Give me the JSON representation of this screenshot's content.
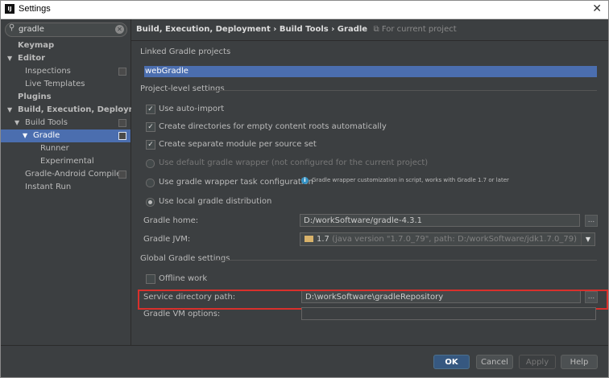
{
  "window": {
    "title": "Settings",
    "close": "✕",
    "app_icon": "IJ"
  },
  "search": {
    "value": "gradle",
    "clear": "✕",
    "icon": "⚲"
  },
  "sidebar": {
    "items": [
      {
        "label": "Keymap"
      },
      {
        "label": "Editor",
        "arrow": "▼"
      },
      {
        "label": "Inspections"
      },
      {
        "label": "Live Templates"
      },
      {
        "label": "Plugins"
      },
      {
        "label": "Build, Execution, Deployment",
        "arrow": "▼"
      },
      {
        "label": "Build Tools",
        "arrow": "▼"
      },
      {
        "label": "Gradle",
        "arrow": "▼"
      },
      {
        "label": "Runner"
      },
      {
        "label": "Experimental"
      },
      {
        "label": "Gradle-Android Compiler"
      },
      {
        "label": "Instant Run"
      }
    ]
  },
  "breadcrumb": {
    "text": "Build, Execution, Deployment › Build Tools › Gradle",
    "scope": "For current project"
  },
  "linked": {
    "header": "Linked Gradle projects",
    "project": "webGradle"
  },
  "project_level": {
    "header": "Project-level settings",
    "auto_import": "Use auto-import",
    "create_dirs": "Create directories for empty content roots automatically",
    "separate_module": "Create separate module per source set",
    "default_wrapper": "Use default gradle wrapper (not configured for the current project)",
    "wrapper_task": "Use gradle wrapper task configuration",
    "wrapper_note": "Gradle wrapper customization in script, works with Gradle 1.7 or later",
    "local_dist": "Use local gradle distribution",
    "checkmark": "✓",
    "info": "i"
  },
  "fields": {
    "home_label": "Gradle home:",
    "home_value": "D:/workSoftware/gradle-4.3.1",
    "jvm_label": "Gradle JVM:",
    "jvm_version": "1.7",
    "jvm_hint": "(java version \"1.7.0_79\", path: D:/workSoftware/jdk1.7.0_79)",
    "browse": "...",
    "dropdown": "▼"
  },
  "global": {
    "header": "Global Gradle settings",
    "offline": "Offline work",
    "service_label": "Service directory path:",
    "service_value": "D:\\workSoftware\\gradleRepository",
    "vm_label": "Gradle VM options:",
    "vm_value": ""
  },
  "buttons": {
    "ok": "OK",
    "cancel": "Cancel",
    "apply": "Apply",
    "help": "Help"
  },
  "colors": {
    "selection": "#4b6eaf",
    "highlight": "#d9302c",
    "panel": "#3c3f41"
  }
}
